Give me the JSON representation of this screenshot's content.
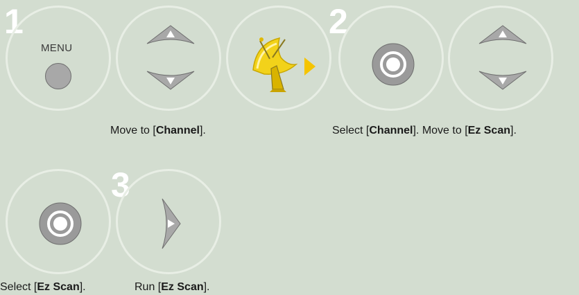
{
  "step_numbers": [
    "1",
    "2",
    "3"
  ],
  "menu_label": "MENU",
  "captions": {
    "move_channel": {
      "pre": "Move to [",
      "bold": "Channel",
      "post": "]."
    },
    "select_channel": {
      "pre": "Select [",
      "bold": "Channel",
      "post": "]. "
    },
    "move_ezscan": {
      "pre": "Move to [",
      "bold": "Ez Scan",
      "post": "]."
    },
    "select_ezscan": {
      "pre": "Select [",
      "bold": "Ez Scan",
      "post": "]."
    },
    "run_ezscan": {
      "pre": "Run [",
      "bold": "Ez Scan",
      "post": "]."
    }
  },
  "icons": {
    "menu": "menu-button-icon",
    "updown": "up-down-arrow-icon",
    "ok": "ok-button-icon",
    "satellite": "satellite-dish-icon",
    "right": "right-arrow-icon"
  },
  "colors": {
    "background": "#d3ddd0",
    "circle_border": "#e8eee5",
    "button_gray": "#a8a8a8",
    "dish_yellow": "#f2d21a",
    "arrow_yellow": "#f5c400"
  }
}
